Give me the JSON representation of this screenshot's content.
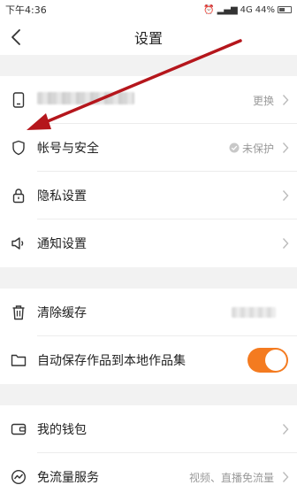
{
  "status_bar": {
    "time": "下午4:36",
    "battery_text": "44%",
    "network": "4G"
  },
  "header": {
    "title": "设置"
  },
  "colors": {
    "accent": "#f47b20",
    "annotation": "#b5161c"
  },
  "groups": [
    {
      "items": [
        {
          "id": "phone",
          "icon": "phone-icon",
          "label": "",
          "value": "更换"
        },
        {
          "id": "account-security",
          "icon": "shield-icon",
          "label": "帐号与安全",
          "value": "未保护"
        },
        {
          "id": "privacy",
          "icon": "lock-icon",
          "label": "隐私设置",
          "value": ""
        },
        {
          "id": "notifications",
          "icon": "speaker-icon",
          "label": "通知设置",
          "value": ""
        }
      ]
    },
    {
      "items": [
        {
          "id": "clear-cache",
          "icon": "trash-icon",
          "label": "清除缓存",
          "value": ""
        },
        {
          "id": "auto-save",
          "icon": "folder-icon",
          "label": "自动保存作品到本地作品集",
          "toggle_on": true
        }
      ]
    },
    {
      "items": [
        {
          "id": "wallet",
          "icon": "wallet-icon",
          "label": "我的钱包",
          "value": ""
        },
        {
          "id": "free-data",
          "icon": "speed-icon",
          "label": "免流量服务",
          "value": "视频、直播免流量"
        }
      ]
    }
  ]
}
